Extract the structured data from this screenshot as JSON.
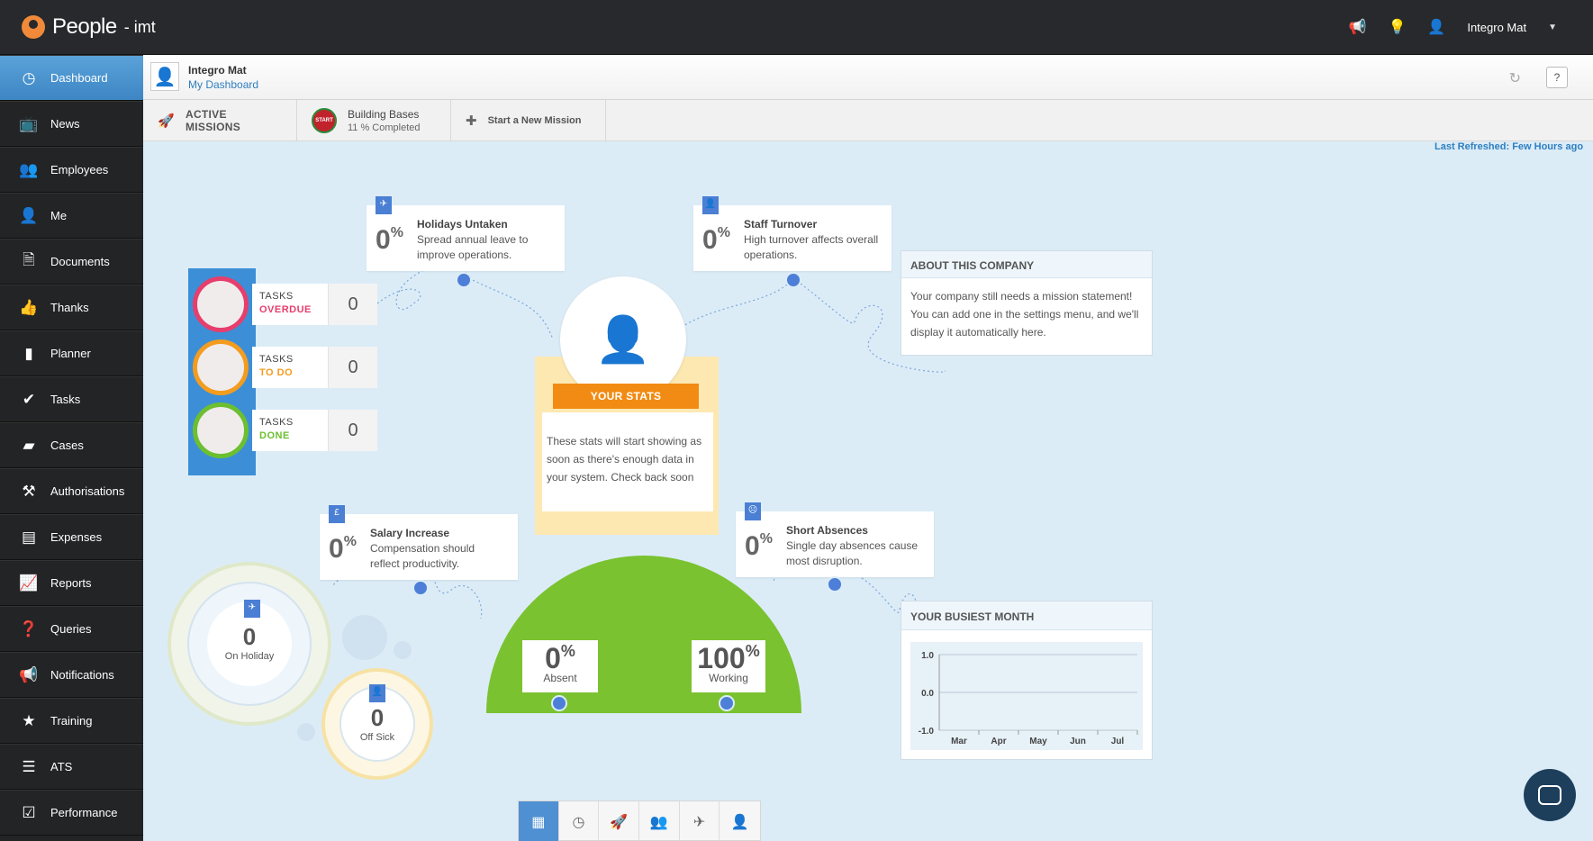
{
  "app": {
    "brand": "People",
    "subtitle": "- imt"
  },
  "topbar": {
    "user_name": "Integro Mat",
    "icons": [
      "megaphone-icon",
      "lightbulb-icon",
      "user-icon",
      "caret-down-icon"
    ]
  },
  "sidebar": {
    "items": [
      {
        "label": "Dashboard",
        "icon": "dashboard-icon",
        "active": true
      },
      {
        "label": "News",
        "icon": "tv-icon"
      },
      {
        "label": "Employees",
        "icon": "people-icon"
      },
      {
        "label": "Me",
        "icon": "person-icon"
      },
      {
        "label": "Documents",
        "icon": "document-icon"
      },
      {
        "label": "Thanks",
        "icon": "thumbs-up-icon"
      },
      {
        "label": "Planner",
        "icon": "planner-icon"
      },
      {
        "label": "Tasks",
        "icon": "check-icon"
      },
      {
        "label": "Cases",
        "icon": "folder-icon"
      },
      {
        "label": "Authorisations",
        "icon": "gavel-icon"
      },
      {
        "label": "Expenses",
        "icon": "wallet-icon"
      },
      {
        "label": "Reports",
        "icon": "chart-icon"
      },
      {
        "label": "Queries",
        "icon": "question-doc-icon"
      },
      {
        "label": "Notifications",
        "icon": "megaphone-icon"
      },
      {
        "label": "Training",
        "icon": "star-icon"
      },
      {
        "label": "ATS",
        "icon": "list-icon"
      },
      {
        "label": "Performance",
        "icon": "checkbox-icon"
      }
    ]
  },
  "userbar": {
    "name": "Integro Mat",
    "link": "My Dashboard",
    "help": "?"
  },
  "missions": {
    "active_label": "ACTIVE MISSIONS",
    "badge_text": "START",
    "mission_name": "Building Bases",
    "mission_progress": "11 % Completed",
    "new_mission": "Start a New Mission"
  },
  "last_refreshed": "Last Refreshed: Few Hours ago",
  "stat_cards": {
    "holidays": {
      "value": "0",
      "unit": "%",
      "title": "Holidays Untaken",
      "desc": "Spread annual leave to improve operations."
    },
    "turnover": {
      "value": "0",
      "unit": "%",
      "title": "Staff Turnover",
      "desc": "High turnover affects overall operations."
    },
    "salary": {
      "value": "0",
      "unit": "%",
      "title": "Salary Increase",
      "desc": "Compensation should reflect productivity."
    },
    "absences": {
      "value": "0",
      "unit": "%",
      "title": "Short Absences",
      "desc": "Single day absences cause most disruption."
    }
  },
  "tasks": {
    "overdue": {
      "label": "TASKS",
      "status": "OVERDUE",
      "count": "0",
      "color": "#e63e6d"
    },
    "todo": {
      "label": "TASKS",
      "status": "TO DO",
      "count": "0",
      "color": "#f39c1f"
    },
    "done": {
      "label": "TASKS",
      "status": "DONE",
      "count": "0",
      "color": "#6cbf2f"
    }
  },
  "your_stats": {
    "title": "YOUR STATS",
    "text": "These stats will start showing as soon as there's enough data in your system. Check back soon"
  },
  "about": {
    "title": "ABOUT THIS COMPANY",
    "text": "Your company still needs a mission statement! You can add one in the settings menu, and we'll display it automatically here."
  },
  "attendance": {
    "absent": {
      "value": "0",
      "unit": "%",
      "label": "Absent"
    },
    "working": {
      "value": "100",
      "unit": "%",
      "label": "Working"
    }
  },
  "holiday_ring": {
    "value": "0",
    "label": "On Holiday"
  },
  "sick_ring": {
    "value": "0",
    "label": "Off Sick"
  },
  "busiest_month": {
    "title": "YOUR BUSIEST MONTH",
    "chart_data": {
      "type": "line",
      "categories": [
        "Mar",
        "Apr",
        "May",
        "Jun",
        "Jul"
      ],
      "yticks": [
        "1.0",
        "0.0",
        "-1.0"
      ],
      "ylim": [
        -1,
        1
      ],
      "series": []
    }
  },
  "bottom_tabs": [
    "grid-icon",
    "clock-icon",
    "rocket-icon",
    "team-icon",
    "plane-icon",
    "person-icon"
  ],
  "colors": {
    "accent": "#3d86c4",
    "green": "#7ac230",
    "orange": "#f28b13",
    "dot": "#4d7fd8"
  }
}
